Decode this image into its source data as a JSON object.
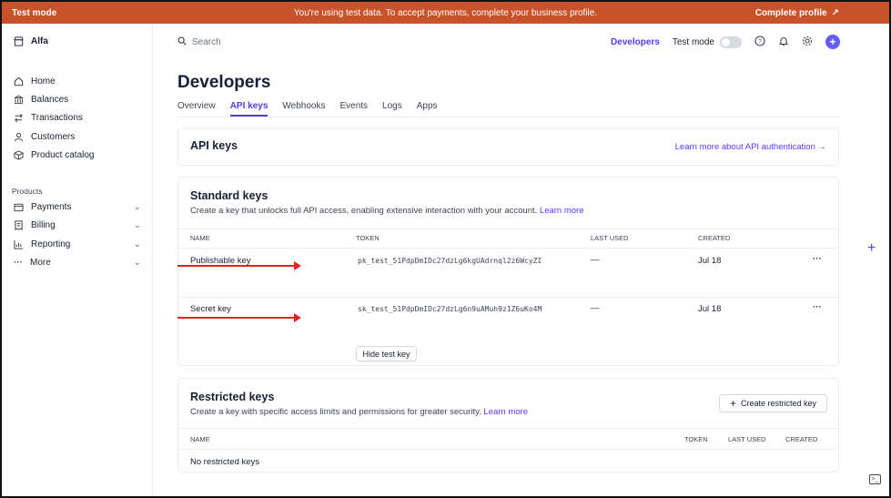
{
  "banner": {
    "mode_label": "Test mode",
    "message": "You're using test data. To accept payments, complete your business profile.",
    "cta_label": "Complete profile",
    "bg_color": "#c8522a"
  },
  "sidebar": {
    "account_name": "Alfa",
    "items": [
      {
        "label": "Home",
        "icon": "home-icon"
      },
      {
        "label": "Balances",
        "icon": "bank-icon"
      },
      {
        "label": "Transactions",
        "icon": "arrows-icon"
      },
      {
        "label": "Customers",
        "icon": "person-icon"
      },
      {
        "label": "Product catalog",
        "icon": "box-icon"
      }
    ],
    "section_label": "Products",
    "product_items": [
      {
        "label": "Payments",
        "icon": "wallet-icon"
      },
      {
        "label": "Billing",
        "icon": "receipt-icon"
      },
      {
        "label": "Reporting",
        "icon": "chart-icon"
      },
      {
        "label": "More",
        "icon": "dots-icon"
      }
    ]
  },
  "topbar": {
    "search_placeholder": "Search",
    "developers_label": "Developers",
    "testmode_label": "Test mode",
    "accent_color": "#533afd"
  },
  "page": {
    "title": "Developers",
    "tabs": [
      "Overview",
      "API keys",
      "Webhooks",
      "Events",
      "Logs",
      "Apps"
    ],
    "active_tab": "API keys"
  },
  "api_keys_card": {
    "title": "API keys",
    "link_label": "Learn more about API authentication →"
  },
  "standard_keys": {
    "title": "Standard keys",
    "description": "Create a key that unlocks full API access, enabling extensive interaction with your account.",
    "learn_more": "Learn more",
    "columns": [
      "NAME",
      "TOKEN",
      "LAST USED",
      "CREATED"
    ],
    "rows": [
      {
        "name": "Publishable key",
        "token": "pk_test_51PdpDmIDc27dzLg6kgUAdrnql2z6WcyZI",
        "last_used": "—",
        "created": "Jul 18"
      },
      {
        "name": "Secret key",
        "token": "sk_test_51PdpDmIDc27dzLg6n9uAMuh9z1Z6uKo4M",
        "last_used": "—",
        "created": "Jul 18"
      }
    ],
    "hide_button": "Hide test key",
    "row_menu": "···"
  },
  "restricted_keys": {
    "title": "Restricted keys",
    "description": "Create a key with specific access limits and permissions for greater security.",
    "learn_more": "Learn more",
    "create_button": "Create restricted key",
    "columns": [
      "NAME",
      "TOKEN",
      "LAST USED",
      "CREATED"
    ],
    "empty_text": "No restricted keys"
  }
}
